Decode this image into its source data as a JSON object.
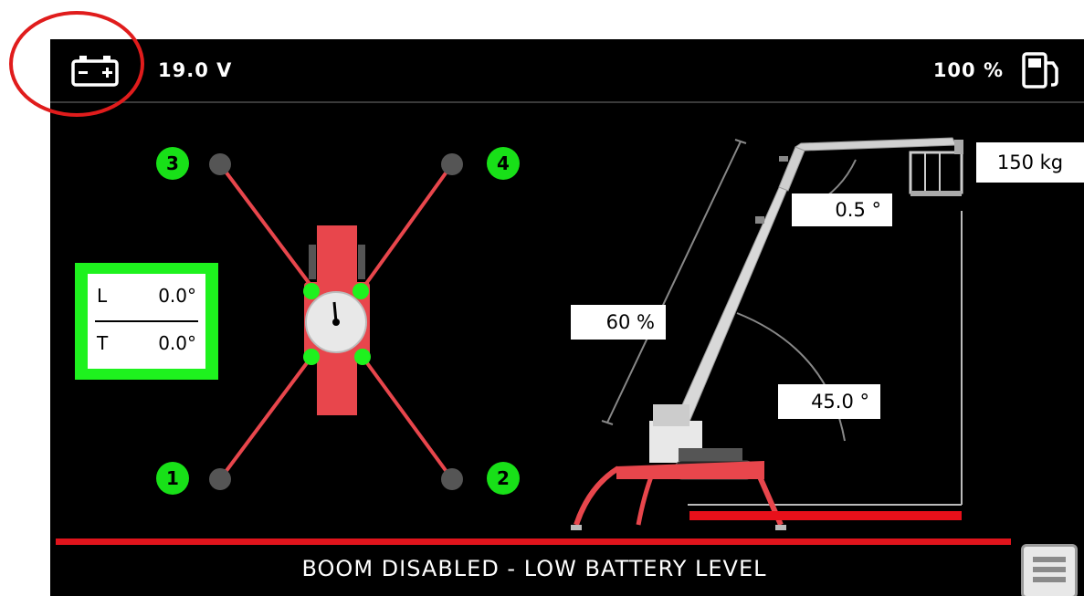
{
  "top_bar": {
    "battery_icon": "battery-icon",
    "voltage": "19.0 V",
    "fuel_percent": "100 %",
    "fuel_icon": "fuel-pump-icon"
  },
  "outriggers": [
    {
      "label": "3"
    },
    {
      "label": "4"
    },
    {
      "label": "1"
    },
    {
      "label": "2"
    }
  ],
  "tilt": {
    "l_label": "L",
    "l_value": "0.0°",
    "t_label": "T",
    "t_value": "0.0°"
  },
  "boom": {
    "jib_angle": "0.5 °",
    "extension": "60 %",
    "boom_angle": "45.0 °",
    "load": "150 kg"
  },
  "status": {
    "message": "BOOM DISABLED - LOW BATTERY LEVEL"
  },
  "menu_button_icon": "menu-icon",
  "colors": {
    "background": "#000000",
    "alert_red": "#e0141c",
    "ok_green": "#18e018",
    "annotation_red": "#e01c1c"
  }
}
